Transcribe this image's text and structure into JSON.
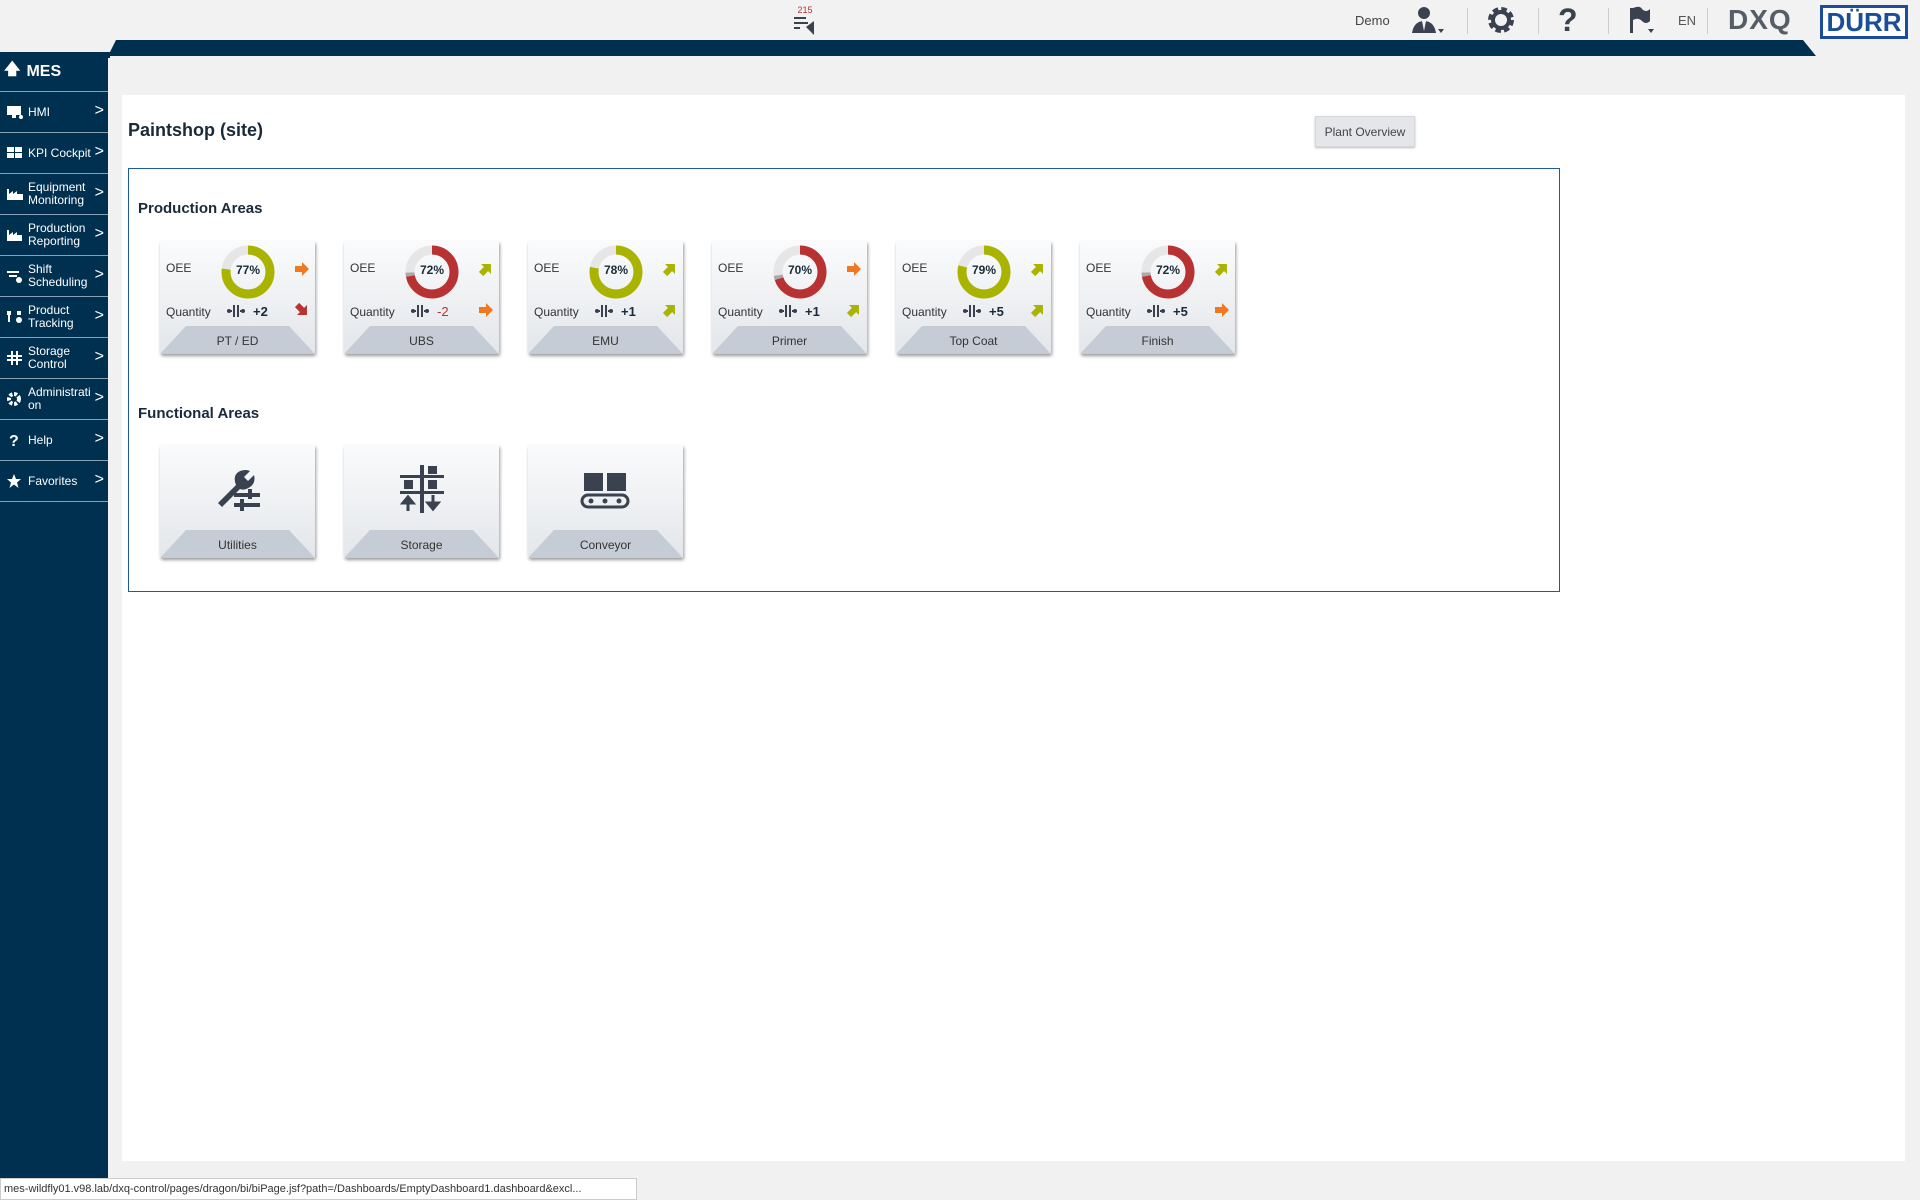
{
  "header": {
    "notification_count": "215",
    "user": "Demo",
    "language": "EN",
    "product_logo": "DXQ",
    "brand_logo": "DÜRR"
  },
  "sidebar": {
    "title": "MES",
    "items": [
      {
        "label": "HMI",
        "icon": "monitor-icon"
      },
      {
        "label": "KPI Cockpit",
        "icon": "grid-icon"
      },
      {
        "label": "Equipment Monitoring",
        "icon": "factory-monitor-icon"
      },
      {
        "label": "Production Reporting",
        "icon": "factory-report-icon"
      },
      {
        "label": "Shift Scheduling",
        "icon": "schedule-icon"
      },
      {
        "label": "Product Tracking",
        "icon": "tracking-icon"
      },
      {
        "label": "Storage Control",
        "icon": "storage-icon"
      },
      {
        "label": "Administrati on",
        "icon": "gear-icon"
      },
      {
        "label": "Help",
        "icon": "question-icon"
      },
      {
        "label": "Favorites",
        "icon": "star-icon"
      }
    ]
  },
  "page": {
    "title": "Paintshop (site)",
    "plant_overview_label": "Plant Overview"
  },
  "production": {
    "title": "Production Areas",
    "oee_label": "OEE",
    "quantity_label": "Quantity",
    "areas": [
      {
        "name": "PT / ED",
        "oee": 77,
        "oee_text": "77%",
        "status": "good",
        "oee_trend": "right",
        "quantity": "+2",
        "qty_trend": "down"
      },
      {
        "name": "UBS",
        "oee": 72,
        "oee_text": "72%",
        "status": "bad",
        "oee_trend": "up",
        "quantity": "-2",
        "qty_trend": "right"
      },
      {
        "name": "EMU",
        "oee": 78,
        "oee_text": "78%",
        "status": "good",
        "oee_trend": "up",
        "quantity": "+1",
        "qty_trend": "up"
      },
      {
        "name": "Primer",
        "oee": 70,
        "oee_text": "70%",
        "status": "bad",
        "oee_trend": "right",
        "quantity": "+1",
        "qty_trend": "up"
      },
      {
        "name": "Top Coat",
        "oee": 79,
        "oee_text": "79%",
        "status": "good",
        "oee_trend": "up",
        "quantity": "+5",
        "qty_trend": "up"
      },
      {
        "name": "Finish",
        "oee": 72,
        "oee_text": "72%",
        "status": "bad",
        "oee_trend": "up",
        "quantity": "+5",
        "qty_trend": "right"
      }
    ]
  },
  "functional": {
    "title": "Functional Areas",
    "areas": [
      {
        "name": "Utilities",
        "icon": "utilities-icon"
      },
      {
        "name": "Storage",
        "icon": "storage-icon"
      },
      {
        "name": "Conveyor",
        "icon": "conveyor-icon"
      }
    ]
  },
  "colors": {
    "good": "#a8b400",
    "bad": "#b83232",
    "neutral": "#f07820",
    "navy": "#003050",
    "track": "#e6e6e6"
  },
  "statusbar": {
    "url": "mes-wildfly01.v98.lab/dxq-control/pages/dragon/bi/biPage.jsf?path=/Dashboards/EmptyDashboard1.dashboard&excl..."
  }
}
